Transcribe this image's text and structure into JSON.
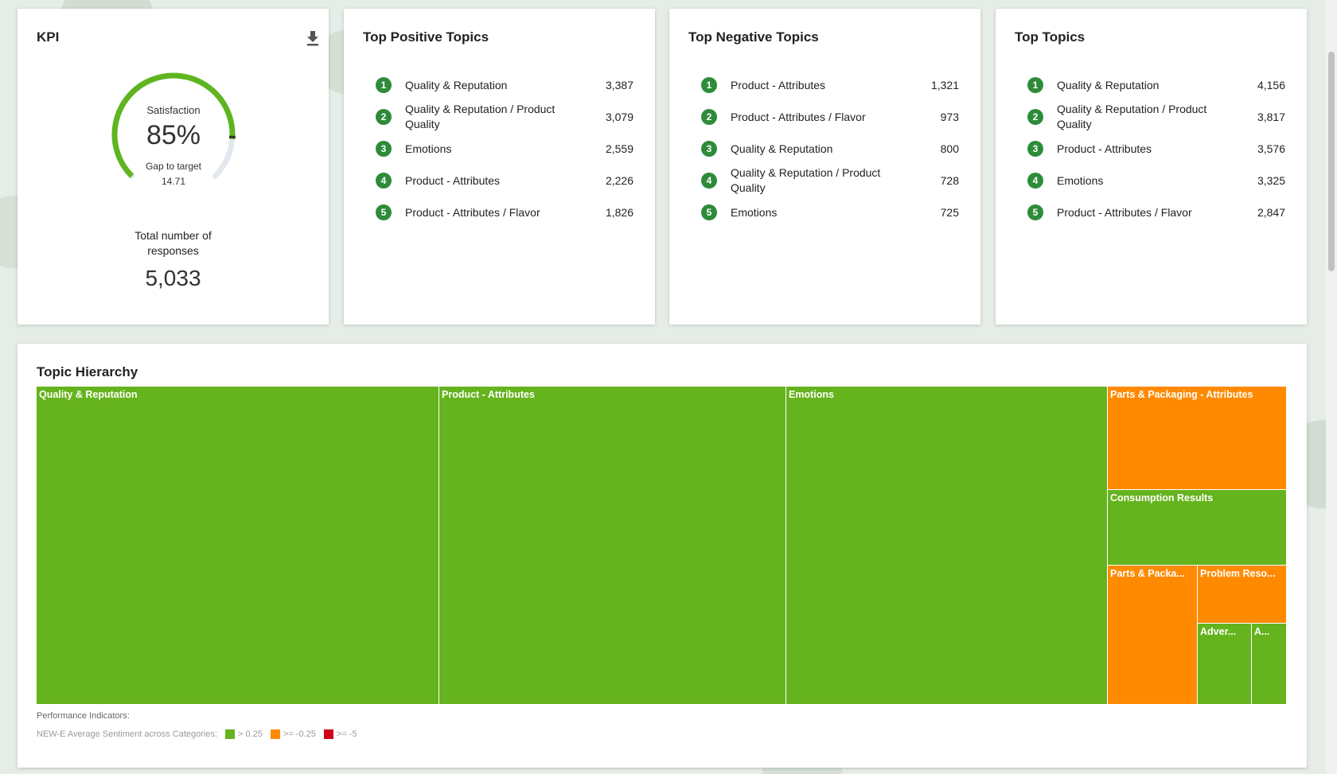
{
  "kpi": {
    "title": "KPI",
    "download_icon": "download-icon",
    "satisfaction_label": "Satisfaction",
    "satisfaction_value": "85%",
    "satisfaction_fraction": 0.85,
    "gap_label": "Gap to target",
    "gap_value": "14.71",
    "total_label_line1": "Total number of",
    "total_label_line2": "responses",
    "total_value": "5,033",
    "colors": {
      "arc": "#5fb520",
      "track": "#e3e8ee",
      "marker": "#333333"
    }
  },
  "positive": {
    "title": "Top Positive Topics",
    "items": [
      {
        "rank": "1",
        "name": "Quality & Reputation",
        "count": "3,387"
      },
      {
        "rank": "2",
        "name": "Quality & Reputation / Product Quality",
        "count": "3,079"
      },
      {
        "rank": "3",
        "name": "Emotions",
        "count": "2,559"
      },
      {
        "rank": "4",
        "name": "Product - Attributes",
        "count": "2,226"
      },
      {
        "rank": "5",
        "name": "Product - Attributes / Flavor",
        "count": "1,826"
      }
    ]
  },
  "negative": {
    "title": "Top Negative Topics",
    "items": [
      {
        "rank": "1",
        "name": "Product - Attributes",
        "count": "1,321"
      },
      {
        "rank": "2",
        "name": "Product - Attributes / Flavor",
        "count": "973"
      },
      {
        "rank": "3",
        "name": "Quality & Reputation",
        "count": "800"
      },
      {
        "rank": "4",
        "name": "Quality & Reputation / Product Quality",
        "count": "728"
      },
      {
        "rank": "5",
        "name": "Emotions",
        "count": "725"
      }
    ]
  },
  "top": {
    "title": "Top Topics",
    "items": [
      {
        "rank": "1",
        "name": "Quality & Reputation",
        "count": "4,156"
      },
      {
        "rank": "2",
        "name": "Quality & Reputation / Product Quality",
        "count": "3,817"
      },
      {
        "rank": "3",
        "name": "Product - Attributes",
        "count": "3,576"
      },
      {
        "rank": "4",
        "name": "Emotions",
        "count": "3,325"
      },
      {
        "rank": "5",
        "name": "Product - Attributes / Flavor",
        "count": "2,847"
      }
    ]
  },
  "hierarchy": {
    "title": "Topic Hierarchy",
    "tiles": {
      "quality": "Quality & Reputation",
      "product": "Product - Attributes",
      "emotions": "Emotions",
      "packaging_attr": "Parts & Packaging - Attributes",
      "consumption": "Consumption Results",
      "parts_packa": "Parts & Packa...",
      "problem_reso": "Problem Reso...",
      "adver": "Adver...",
      "a": "A..."
    },
    "legend_title": "Performance Indicators:",
    "legend_label": "NEW-E Average Sentiment across Categories:",
    "legend_items": [
      {
        "label": "> 0.25",
        "color": "#65b31d"
      },
      {
        "label": ">= -0.25",
        "color": "#ff8a00"
      },
      {
        "label": ">= -5",
        "color": "#d0021b"
      }
    ]
  },
  "colors": {
    "positive": "#65b31d",
    "neutral": "#ff8a00",
    "negative": "#d0021b",
    "rank_badge": "#2e8b3a"
  }
}
